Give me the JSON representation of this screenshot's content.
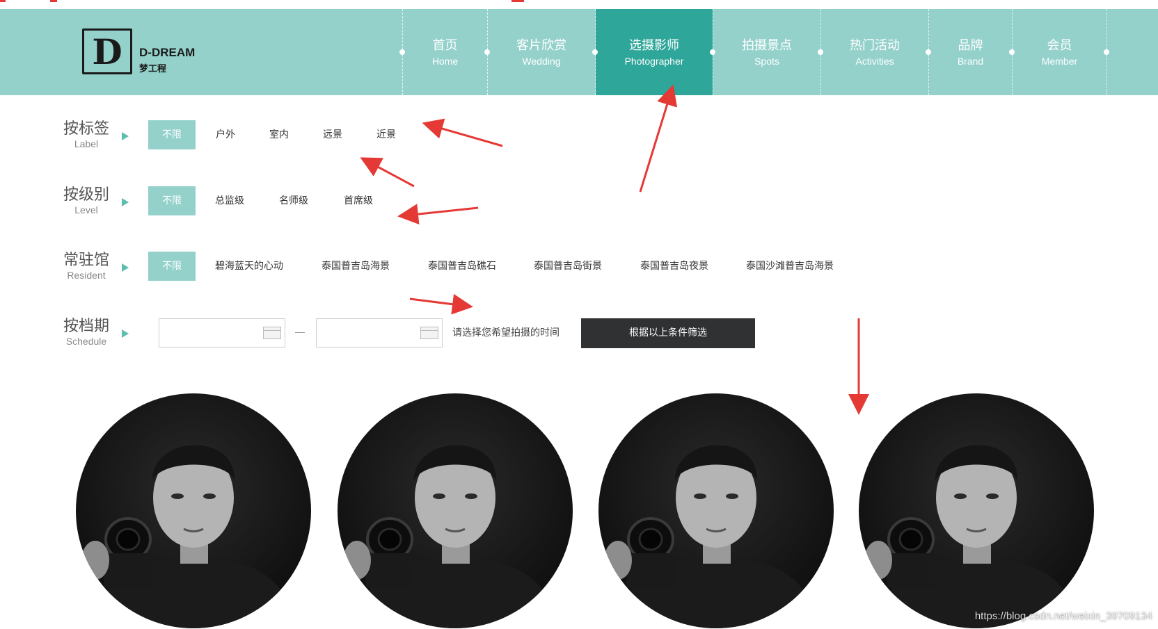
{
  "brand": {
    "name": "D-DREAM",
    "subtitle": "梦工程",
    "mark": "D"
  },
  "nav": [
    {
      "cn": "首页",
      "en": "Home"
    },
    {
      "cn": "客片欣赏",
      "en": "Wedding"
    },
    {
      "cn": "选摄影师",
      "en": "Photographer",
      "active": true
    },
    {
      "cn": "拍摄景点",
      "en": "Spots"
    },
    {
      "cn": "热门活动",
      "en": "Activities"
    },
    {
      "cn": "品牌",
      "en": "Brand"
    },
    {
      "cn": "会员",
      "en": "Member"
    }
  ],
  "filters": {
    "label": {
      "cn": "按标签",
      "en": "Label",
      "options": [
        "不限",
        "户外",
        "室内",
        "远景",
        "近景"
      ]
    },
    "level": {
      "cn": "按级别",
      "en": "Level",
      "options": [
        "不限",
        "总监级",
        "名师级",
        "首席级"
      ]
    },
    "resident": {
      "cn": "常驻馆",
      "en": "Resident",
      "options": [
        "不限",
        "碧海蓝天的心动",
        "泰国普吉岛海景",
        "泰国普吉岛礁石",
        "泰国普吉岛街景",
        "泰国普吉岛夜景",
        "泰国沙滩普吉岛海景"
      ]
    },
    "schedule": {
      "cn": "按档期",
      "en": "Schedule",
      "start_value": "",
      "end_value": "",
      "hint": "请选择您希望拍摄的时间",
      "button": "根据以上条件筛选"
    }
  },
  "photographers_count_visible": 4,
  "watermark": "https://blog.csdn.net/weixin_39709134",
  "colors": {
    "header": "#94d1cb",
    "active": "#2ea699",
    "selected": "#94d1cb",
    "button": "#2f3133",
    "annotation_arrow": "#e53935"
  }
}
